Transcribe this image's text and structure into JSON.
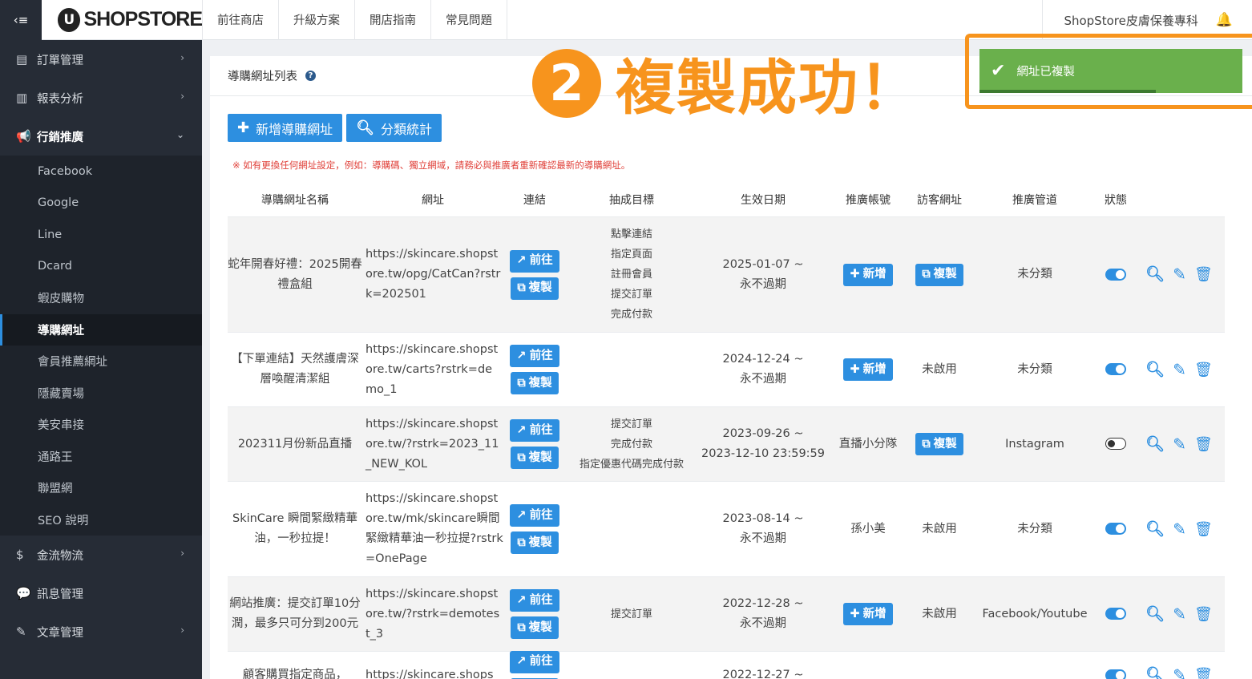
{
  "topbar": {
    "logo_mark": "U",
    "logo_text": "SHOPSTORE",
    "nav": [
      "前往商店",
      "升級方案",
      "開店指南",
      "常見問題"
    ],
    "store_name": "ShopStore皮膚保養專科"
  },
  "sidebar": {
    "items_top": [
      {
        "icon": "clipboard-icon",
        "label": "訂單管理"
      },
      {
        "icon": "bar-chart-icon",
        "label": "報表分析"
      }
    ],
    "active": {
      "icon": "bullhorn-icon",
      "label": "行銷推廣"
    },
    "sub_items": [
      "Facebook",
      "Google",
      "Line",
      "Dcard",
      "蝦皮購物",
      "導購網址",
      "會員推薦網址",
      "隱藏賣場",
      "美安串接",
      "通路王",
      "聯盟網",
      "SEO 說明"
    ],
    "selected_sub": "導購網址",
    "items_bottom": [
      {
        "icon": "dollar-icon",
        "label": "金流物流"
      },
      {
        "icon": "chat-icon",
        "label": "訊息管理"
      },
      {
        "icon": "edit-icon",
        "label": "文章管理"
      }
    ]
  },
  "panel": {
    "title": "導購網址列表",
    "add_button": "新增導購網址",
    "stats_button": "分類統計",
    "notice": "※ 如有更換任何網址設定，例如：導購碼、獨立網域，請務必與推廣者重新確認最新的導購網址。"
  },
  "table": {
    "headers": [
      "導購網址名稱",
      "網址",
      "連結",
      "抽成目標",
      "生效日期",
      "推廣帳號",
      "訪客網址",
      "推廣管道",
      "狀態"
    ],
    "go_label": "前往",
    "copy_label": "複製",
    "add_label": "新增",
    "rows": [
      {
        "name": "蛇年開春好禮：2025開春禮盒組",
        "url": "https://skincare.shopstore.tw/opg/CatCan?rstrk=202501",
        "targets": [
          "點擊連結",
          "指定頁面",
          "註冊會員",
          "提交訂單",
          "完成付款"
        ],
        "date1": "2025-01-07 ~",
        "date2": "永不過期",
        "account_type": "add",
        "account": "",
        "visitor_type": "copy",
        "visitor": "",
        "channel": "未分類",
        "enabled": true
      },
      {
        "name": "【下單連結】天然護膚深層喚醒清潔組",
        "url": "https://skincare.shopstore.tw/carts?rstrk=demo_1",
        "targets": [],
        "date1": "2024-12-24 ~",
        "date2": "永不過期",
        "account_type": "add",
        "account": "",
        "visitor_type": "text",
        "visitor": "未啟用",
        "channel": "未分類",
        "enabled": true
      },
      {
        "name": "202311月份新品直播",
        "url": "https://skincare.shopstore.tw/?rstrk=2023_11_NEW_KOL",
        "targets": [
          "提交訂單",
          "完成付款",
          "指定優惠代碼完成付款"
        ],
        "date1": "2023-09-26 ~",
        "date2": "2023-12-10 23:59:59",
        "account_type": "text",
        "account": "直播小分隊",
        "visitor_type": "copy",
        "visitor": "",
        "channel": "Instagram",
        "enabled": false
      },
      {
        "name": "SkinCare 瞬間緊緻精華油，一秒拉提！",
        "url": "https://skincare.shopstore.tw/mk/skincare瞬間緊緻精華油一秒拉提?rstrk=OnePage",
        "targets": [],
        "date1": "2023-08-14 ~",
        "date2": "永不過期",
        "account_type": "text",
        "account": "孫小美",
        "visitor_type": "text",
        "visitor": "未啟用",
        "channel": "未分類",
        "enabled": true
      },
      {
        "name": "網站推廣：提交訂單10分潤，最多只可分到200元",
        "url": "https://skincare.shopstore.tw/?rstrk=demotest_3",
        "targets": [
          "提交訂單"
        ],
        "date1": "2022-12-28 ~",
        "date2": "永不過期",
        "account_type": "add",
        "account": "",
        "visitor_type": "text",
        "visitor": "未啟用",
        "channel": "Facebook/Youtube",
        "enabled": true
      },
      {
        "name": "顧客購買指定商品，",
        "url": "https://skincare.shops",
        "targets": [],
        "date1": "2022-12-27 ~",
        "date2": "",
        "account_type": "text",
        "account": "",
        "visitor_type": "text",
        "visitor": "",
        "channel": "",
        "enabled": true
      }
    ]
  },
  "annotation": {
    "number": "2",
    "text": "複製成功！"
  },
  "toast": {
    "message": "網址已複製",
    "progress": 0.67
  },
  "colors": {
    "accent": "#2d8fe0",
    "annotation": "#f7941d",
    "toast": "#6ab04c",
    "sidebar": "#262c36"
  }
}
